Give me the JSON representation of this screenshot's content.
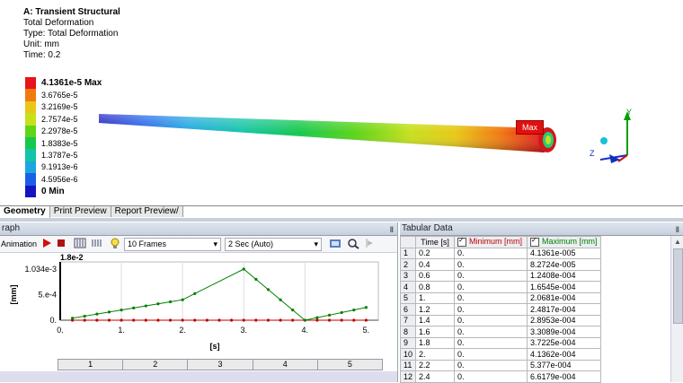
{
  "info": {
    "title": "A: Transient Structural",
    "lines": [
      "Total Deformation",
      "Type: Total Deformation",
      "Unit: mm",
      "Time: 0.2"
    ]
  },
  "legend": [
    {
      "label": "4.1361e-5 Max",
      "color": "#e8141b"
    },
    {
      "label": "3.6765e-5",
      "color": "#f07a10"
    },
    {
      "label": "3.2169e-5",
      "color": "#e8c816"
    },
    {
      "label": "2.7574e-5",
      "color": "#c8e01c"
    },
    {
      "label": "2.2978e-5",
      "color": "#5fd418"
    },
    {
      "label": "1.8383e-5",
      "color": "#17c84e"
    },
    {
      "label": "1.3787e-5",
      "color": "#12c4a8"
    },
    {
      "label": "9.1913e-6",
      "color": "#1aa6e0"
    },
    {
      "label": "4.5956e-6",
      "color": "#1a5fe8"
    },
    {
      "label": "0 Min",
      "color": "#1414c0"
    }
  ],
  "model": {
    "max_tag": "Max"
  },
  "triad": {
    "y_label": "Y",
    "z_label": "Z"
  },
  "tabs": [
    "Geometry",
    "Print Preview",
    "Report Preview/"
  ],
  "graph": {
    "title": "raph",
    "pin": "Ⅱ",
    "animation_label": "Animation",
    "frames": "10 Frames",
    "duration": "2 Sec (Auto)"
  },
  "chart_data": {
    "type": "line",
    "ylabel": "[mm]",
    "xlabel": "[s]",
    "y_top_label": "1.8e-2",
    "y_ticks": [
      "1.034e-3",
      "5.e-4",
      "0."
    ],
    "x_ticks": [
      "0.",
      "1.",
      "2.",
      "3.",
      "4.",
      "5."
    ],
    "xlim": [
      0,
      5.2
    ],
    "ylim": [
      0,
      0.001034
    ],
    "series": [
      {
        "name": "Minimum [mm]",
        "color": "#c00000",
        "x": [
          0.2,
          0.4,
          0.6,
          0.8,
          1.0,
          1.2,
          1.4,
          1.6,
          1.8,
          2.0,
          2.2,
          2.4,
          2.6,
          2.8,
          3.0,
          3.2,
          3.4,
          3.6,
          3.8,
          4.0,
          4.2,
          4.4,
          4.6,
          4.8,
          5.0
        ],
        "y": [
          0,
          0,
          0,
          0,
          0,
          0,
          0,
          0,
          0,
          0,
          0,
          0,
          0,
          0,
          0,
          0,
          0,
          0,
          0,
          0,
          0,
          0,
          0,
          0,
          0
        ]
      },
      {
        "name": "Maximum [mm]",
        "color": "#008000",
        "x": [
          0.2,
          0.4,
          0.6,
          0.8,
          1.0,
          1.2,
          1.4,
          1.6,
          1.8,
          2.0,
          2.2,
          3.0,
          3.2,
          3.4,
          3.6,
          3.8,
          4.0,
          4.2,
          4.4,
          4.6,
          4.8,
          5.0
        ],
        "y": [
          4.1361e-05,
          8.2724e-05,
          0.00012408,
          0.00016545,
          0.00020681,
          0.00024817,
          0.00028953,
          0.00033089,
          0.00037225,
          0.00041362,
          0.0005377,
          0.001034,
          0.000827,
          0.00062,
          0.000413,
          0.000207,
          0,
          5.2e-05,
          0.000103,
          0.000155,
          0.000207,
          0.000258
        ]
      }
    ]
  },
  "stages": [
    "1",
    "2",
    "3",
    "4",
    "5"
  ],
  "tabular": {
    "title": "Tabular Data",
    "pin": "Ⅱ",
    "headers": [
      "Time [s]",
      "Minimum [mm]",
      "Maximum [mm]"
    ],
    "rows": [
      [
        "1",
        "0.2",
        "0.",
        "4.1361e-005"
      ],
      [
        "2",
        "0.4",
        "0.",
        "8.2724e-005"
      ],
      [
        "3",
        "0.6",
        "0.",
        "1.2408e-004"
      ],
      [
        "4",
        "0.8",
        "0.",
        "1.6545e-004"
      ],
      [
        "5",
        "1.",
        "0.",
        "2.0681e-004"
      ],
      [
        "6",
        "1.2",
        "0.",
        "2.4817e-004"
      ],
      [
        "7",
        "1.4",
        "0.",
        "2.8953e-004"
      ],
      [
        "8",
        "1.6",
        "0.",
        "3.3089e-004"
      ],
      [
        "9",
        "1.8",
        "0.",
        "3.7225e-004"
      ],
      [
        "10",
        "2.",
        "0.",
        "4.1362e-004"
      ],
      [
        "11",
        "2.2",
        "0.",
        "5.377e-004"
      ],
      [
        "12",
        "2.4",
        "0.",
        "6.6179e-004"
      ]
    ]
  }
}
